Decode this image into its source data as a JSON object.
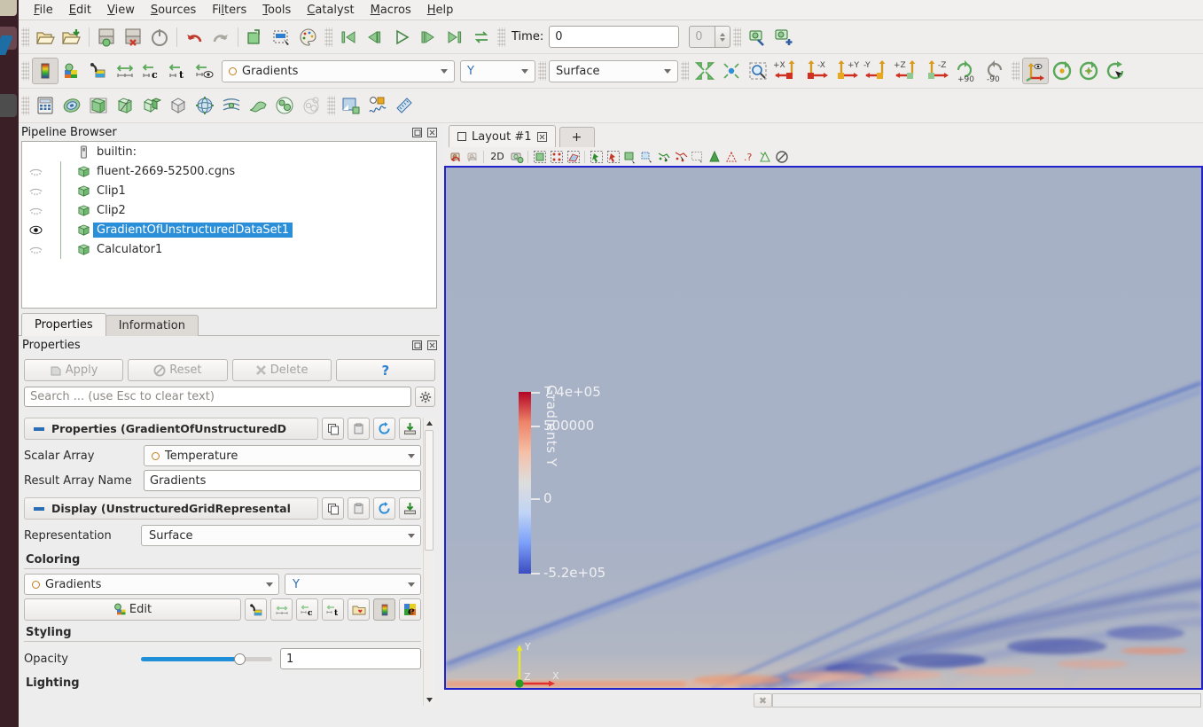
{
  "app": {
    "title": "ParaView"
  },
  "menubar": {
    "items": [
      {
        "label": "File",
        "mnemonic": "F"
      },
      {
        "label": "Edit",
        "mnemonic": "E"
      },
      {
        "label": "View",
        "mnemonic": "V"
      },
      {
        "label": "Sources",
        "mnemonic": "S"
      },
      {
        "label": "Filters",
        "mnemonic": "l"
      },
      {
        "label": "Tools",
        "mnemonic": "T"
      },
      {
        "label": "Catalyst",
        "mnemonic": "C"
      },
      {
        "label": "Macros",
        "mnemonic": "M"
      },
      {
        "label": "Help",
        "mnemonic": "H"
      }
    ]
  },
  "toolbar_main": {
    "icons": [
      "open-file-icon",
      "open-recent-icon",
      "save-data-icon",
      "save-state-icon",
      "reset-session-icon",
      "undo-icon",
      "redo-icon",
      "undo-camera-icon",
      "select-color-icon",
      "color-palette-icon"
    ],
    "vcr": [
      "first-frame-icon",
      "previous-frame-icon",
      "play-icon",
      "next-frame-icon",
      "last-frame-icon",
      "loop-icon"
    ],
    "time_label": "Time:",
    "time_value": "0",
    "frame_value": "0",
    "macro_icons": [
      "camera-link-icon",
      "camera-add-icon"
    ]
  },
  "toolbar_repr": {
    "icons": [
      "edit-color-map-icon",
      "choose-preset-icon",
      "edit-color-legend-icon",
      "rescale-to-data-icon",
      "rescale-custom-icon",
      "rescale-temporal-icon",
      "rescale-visible-icon"
    ],
    "array_combo": {
      "value": "Gradients",
      "icon": "point-data-icon"
    },
    "component_combo": {
      "value": "Y"
    },
    "representation_combo": {
      "value": "Surface"
    },
    "camera_icons": [
      "reset-camera-icon",
      "zoom-to-data-icon",
      "zoom-to-box-icon"
    ],
    "axis_buttons": [
      "+X",
      "-X",
      "+Y",
      "-Y",
      "+Z",
      "-Z"
    ],
    "rotate_buttons": [
      "+90",
      "-90"
    ],
    "interaction_icons": [
      "show-center-icon",
      "reset-center-icon",
      "pick-center-icon",
      "rotate-camera-icon"
    ]
  },
  "toolbar_filters": {
    "icons": [
      "calculator-icon",
      "contour-icon",
      "clip-icon",
      "slice-icon",
      "threshold-icon",
      "extract-subset-icon",
      "glyph-icon",
      "stream-tracer-icon",
      "warp-icon",
      "group-datasets-icon",
      "extract-level-icon",
      "plot-over-line-icon",
      "plot-selection-icon",
      "ruler-icon"
    ]
  },
  "pipeline": {
    "title": "Pipeline Browser",
    "items": [
      {
        "label": "builtin:",
        "icon": "server-icon",
        "visible": null,
        "selected": false
      },
      {
        "label": "fluent-2669-52500.cgns",
        "icon": "dataset-icon",
        "visible": false,
        "selected": false
      },
      {
        "label": "Clip1",
        "icon": "dataset-icon",
        "visible": false,
        "selected": false
      },
      {
        "label": "Clip2",
        "icon": "dataset-icon",
        "visible": false,
        "selected": false
      },
      {
        "label": "GradientOfUnstructuredDataSet1",
        "icon": "dataset-icon",
        "visible": true,
        "selected": true
      },
      {
        "label": "Calculator1",
        "icon": "dataset-icon",
        "visible": false,
        "selected": false
      }
    ]
  },
  "properties": {
    "tabs": [
      {
        "label": "Properties",
        "active": true
      },
      {
        "label": "Information",
        "active": false
      }
    ],
    "dock_title": "Properties",
    "buttons": {
      "apply": "Apply",
      "reset": "Reset",
      "delete": "Delete",
      "help": "?"
    },
    "search": {
      "placeholder": "Search ... (use Esc to clear text)",
      "value": ""
    },
    "section_properties": {
      "title": "Properties (GradientOfUnstructuredD"
    },
    "scalar_array": {
      "label": "Scalar Array",
      "value": "Temperature"
    },
    "result_array": {
      "label": "Result Array Name",
      "value": "Gradients"
    },
    "section_display": {
      "title": "Display (UnstructuredGridRepresental"
    },
    "representation": {
      "label": "Representation",
      "value": "Surface"
    },
    "coloring": {
      "group": "Coloring",
      "array": "Gradients",
      "component": "Y",
      "edit_label": "Edit",
      "buttons": [
        "choose-preset-icon",
        "rescale-to-data-icon",
        "rescale-custom-icon",
        "rescale-temporal-icon",
        "save-preset-icon",
        "color-legend-icon",
        "edit-color-icon"
      ]
    },
    "styling": {
      "group": "Styling",
      "opacity_label": "Opacity",
      "opacity_value": "1",
      "opacity_percent": 72
    },
    "lighting": {
      "group": "Lighting"
    }
  },
  "layout": {
    "tab_label": "Layout #1",
    "add_tab": "+",
    "view_toolbar": [
      "camera-undo-icon",
      "camera-redo-icon",
      "2D",
      "camera-icon",
      "select-cells-icon",
      "select-points-icon",
      "select-frustum-icon",
      "select-surface-cells-icon",
      "select-surface-points-icon",
      "select-block-icon",
      "hover-cells-icon",
      "hover-points-icon",
      "interactive-select-icon",
      "select-query-icon",
      "plot-over-icon",
      "zoom-to-box-icon",
      "help-selection-icon",
      "link-selection-icon",
      "clear-selection-icon"
    ],
    "toolbar_2d_label": "2D"
  },
  "render_view": {
    "background_color": "#565a6e",
    "active_border_color": "#2222cc",
    "orientation_axes": {
      "x": "X",
      "y": "Y",
      "z": "Z",
      "x_color": "#e03030",
      "y_color": "#e8e82a",
      "z_color": "#21a021"
    }
  },
  "chart_data": {
    "type": "heatmap",
    "title": "Gradients Y",
    "colormap": "Cool to Warm",
    "colormap_stops": [
      "#3b4cc0",
      "#7b9ff9",
      "#c0d4f5",
      "#dddddd",
      "#f5c0a8",
      "#ee8468",
      "#b40426"
    ],
    "tick_values": [
      740000,
      500000,
      0,
      -520000
    ],
    "tick_labels": [
      "7.4e+05",
      "500000",
      "0",
      "-5.2e+05"
    ],
    "range": [
      -520000,
      740000
    ],
    "orientation": "vertical",
    "legend_position": "left",
    "xlabel": "",
    "ylabel": "",
    "field": "Gradients",
    "component": "Y",
    "source_array": "Temperature"
  },
  "statusbar": {
    "progress_abort": "✖",
    "message": ""
  }
}
